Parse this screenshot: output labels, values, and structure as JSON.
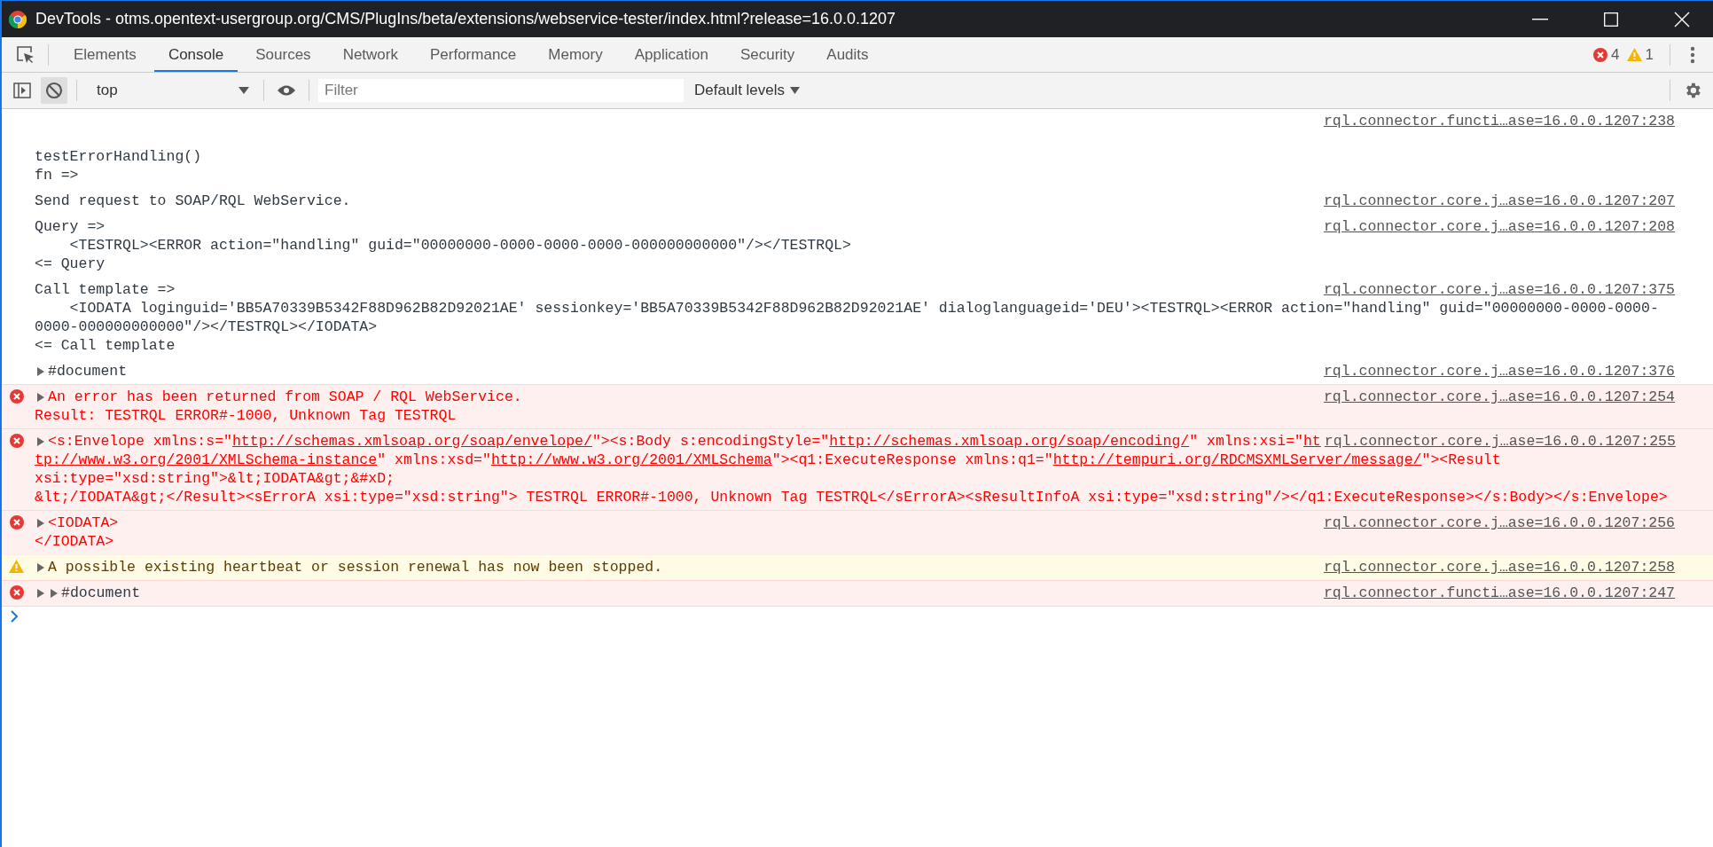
{
  "window": {
    "title": "DevTools - otms.opentext-usergroup.org/CMS/PlugIns/beta/extensions/webservice-tester/index.html?release=16.0.0.1207"
  },
  "tabs": [
    {
      "label": "Elements",
      "selected": false
    },
    {
      "label": "Console",
      "selected": true
    },
    {
      "label": "Sources",
      "selected": false
    },
    {
      "label": "Network",
      "selected": false
    },
    {
      "label": "Performance",
      "selected": false
    },
    {
      "label": "Memory",
      "selected": false
    },
    {
      "label": "Application",
      "selected": false
    },
    {
      "label": "Security",
      "selected": false
    },
    {
      "label": "Audits",
      "selected": false
    }
  ],
  "counters": {
    "errors": "4",
    "warnings": "1"
  },
  "toolbar": {
    "clear_pressed": true,
    "context": "top",
    "filter": {
      "placeholder": "Filter"
    },
    "levels": "Default levels"
  },
  "messages": [
    {
      "kind": "log",
      "source_above": true,
      "source": "rql.connector.functi…ase=16.0.0.1207:238",
      "lines": [
        "testErrorHandling()",
        "fn =>"
      ]
    },
    {
      "kind": "log",
      "source_above": false,
      "source": "rql.connector.core.j…ase=16.0.0.1207:207",
      "lines": [
        "Send request to SOAP/RQL WebService."
      ]
    },
    {
      "kind": "log",
      "source_above": false,
      "source": "rql.connector.core.j…ase=16.0.0.1207:208",
      "lines": [
        "Query =>",
        "    <TESTRQL><ERROR action=\"handling\" guid=\"00000000-0000-0000-0000-000000000000\"/></TESTRQL>",
        "<= Query"
      ]
    },
    {
      "kind": "log",
      "source_above": false,
      "source": "rql.connector.core.j…ase=16.0.0.1207:375",
      "lines": [
        "Call template =>",
        "    <IODATA loginguid='BB5A70339B5342F88D962B82D92021AE' sessionkey='BB5A70339B5342F88D962B82D92021AE' dialoglanguageid='DEU'><TESTRQL><ERROR action=\"handling\" guid=\"00000000-0000-0000-",
        "0000-000000000000\"/></TESTRQL></IODATA>",
        "<= Call template"
      ]
    },
    {
      "kind": "log",
      "source_above": false,
      "source": "rql.connector.core.j…ase=16.0.0.1207:376",
      "arrows": [
        {
          "expanded": false
        }
      ],
      "lines": [
        "#document"
      ]
    },
    {
      "kind": "error",
      "source_above": false,
      "source": "rql.connector.core.j…ase=16.0.0.1207:254",
      "arrows": [
        {
          "expanded": false
        }
      ],
      "lines": [
        "An error has been returned from SOAP / RQL WebService.",
        "Result: TESTRQL ERROR#-1000, Unknown Tag TESTRQL"
      ]
    },
    {
      "kind": "error",
      "source_above": false,
      "source": "rql.connector.core.j…ase=16.0.0.1207:255",
      "arrows": [
        {
          "expanded": false
        }
      ],
      "lines": [
        [
          {
            "text": "<s:Envelope xmlns:s=\"",
            "link": false
          },
          {
            "text": "http://schemas.xmlsoap.org/soap/envelope/",
            "link": true
          },
          {
            "text": "\"><s:Body s:encodingStyle=\"",
            "link": false
          },
          {
            "text": "http://schemas.xmlsoap.org/soap/encoding/",
            "link": true
          },
          {
            "text": "\" xmlns:xsi=\"",
            "link": false
          },
          {
            "text": "ht",
            "link": true
          }
        ],
        [
          {
            "text": "tp://www.w3.org/2001/XMLSchema-instance",
            "link": true
          },
          {
            "text": "\" xmlns:xsd=\"",
            "link": false
          },
          {
            "text": "http://www.w3.org/2001/XMLSchema",
            "link": true
          },
          {
            "text": "\"><q1:ExecuteResponse xmlns:q1=\"",
            "link": false
          },
          {
            "text": "http://tempuri.org/RDCMSXMLServer/message/",
            "link": true
          },
          {
            "text": "\"><Result",
            "link": false
          }
        ],
        "xsi:type=\"xsd:string\">&lt;IODATA&gt;&#xD;",
        "&lt;/IODATA&gt;</Result><sErrorA xsi:type=\"xsd:string\"> TESTRQL ERROR#-1000, Unknown Tag TESTRQL</sErrorA><sResultInfoA xsi:type=\"xsd:string\"/></q1:ExecuteResponse></s:Body></s:Envelope>"
      ]
    },
    {
      "kind": "error",
      "source_above": false,
      "source": "rql.connector.core.j…ase=16.0.0.1207:256",
      "arrows": [
        {
          "expanded": false
        }
      ],
      "lines": [
        "<IODATA>",
        "</IODATA>"
      ]
    },
    {
      "kind": "warning",
      "source_above": false,
      "source": "rql.connector.core.j…ase=16.0.0.1207:258",
      "arrows": [
        {
          "expanded": false
        }
      ],
      "lines": [
        "A possible existing heartbeat or session renewal has now been stopped."
      ]
    },
    {
      "kind": "error_object",
      "source_above": false,
      "source": "rql.connector.functi…ase=16.0.0.1207:247",
      "arrows": [
        {
          "expanded": false
        },
        {
          "expanded": false
        }
      ],
      "lines": [
        "#document"
      ]
    }
  ]
}
